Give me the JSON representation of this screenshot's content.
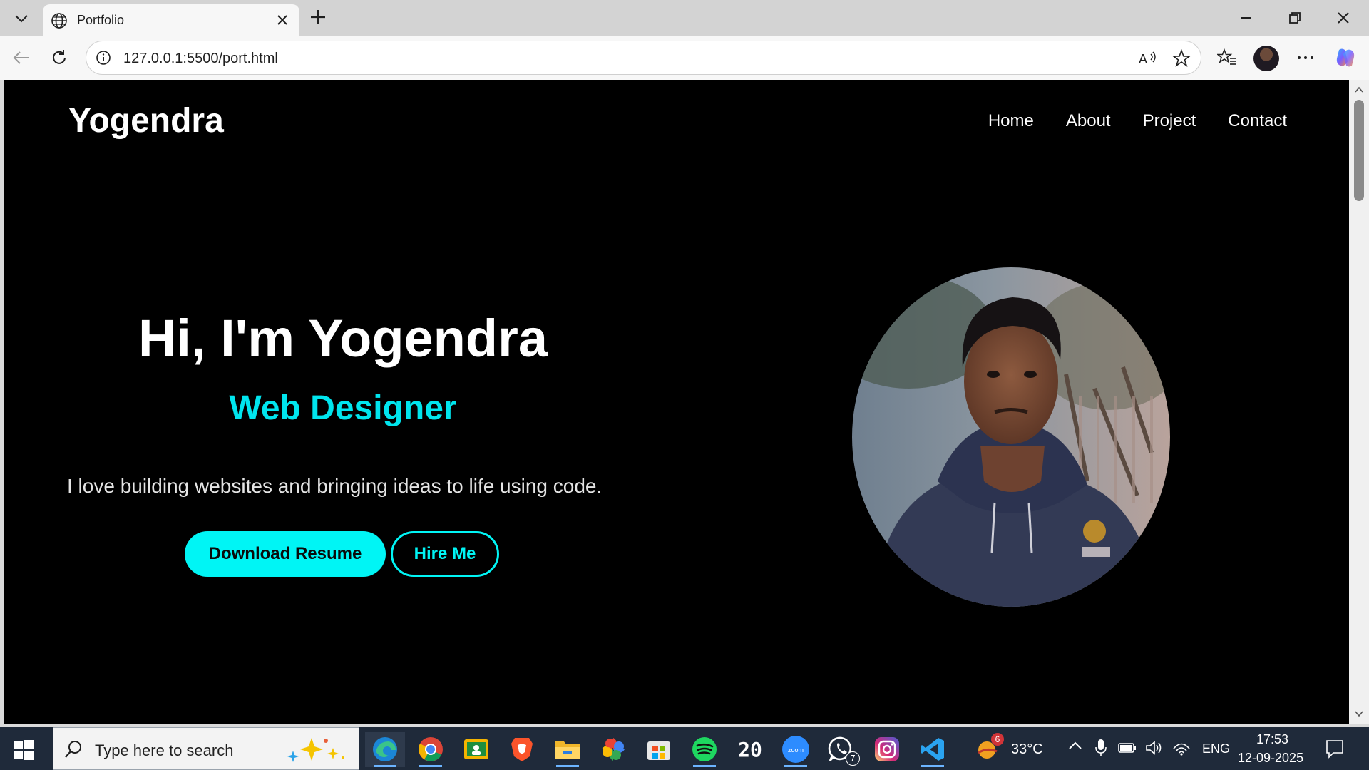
{
  "browser": {
    "tab_title": "Portfolio",
    "url": "127.0.0.1:5500/port.html"
  },
  "page": {
    "logo": "Yogendra",
    "nav": [
      "Home",
      "About",
      "Project",
      "Contact"
    ],
    "hero": {
      "title": "Hi, I'm Yogendra",
      "role": "Web Designer",
      "description": "I love building websites and bringing ideas to life using code.",
      "primary_button": "Download Resume",
      "secondary_button": "Hire Me"
    },
    "colors": {
      "background": "#000000",
      "accent": "#00f5f5",
      "text": "#ffffff"
    }
  },
  "taskbar": {
    "search_placeholder": "Type here to search",
    "pinned_apps": [
      "edge",
      "chrome",
      "classroom",
      "brave",
      "file-explorer",
      "photos",
      "microsoft-store",
      "spotify",
      "calendar",
      "zoom",
      "whatsapp",
      "instagram",
      "vscode"
    ],
    "calendar_day": "20",
    "whatsapp_badge": "7",
    "weather_badge": "6",
    "temperature": "33°C",
    "language": "ENG",
    "time": "17:53",
    "date": "12-09-2025"
  }
}
